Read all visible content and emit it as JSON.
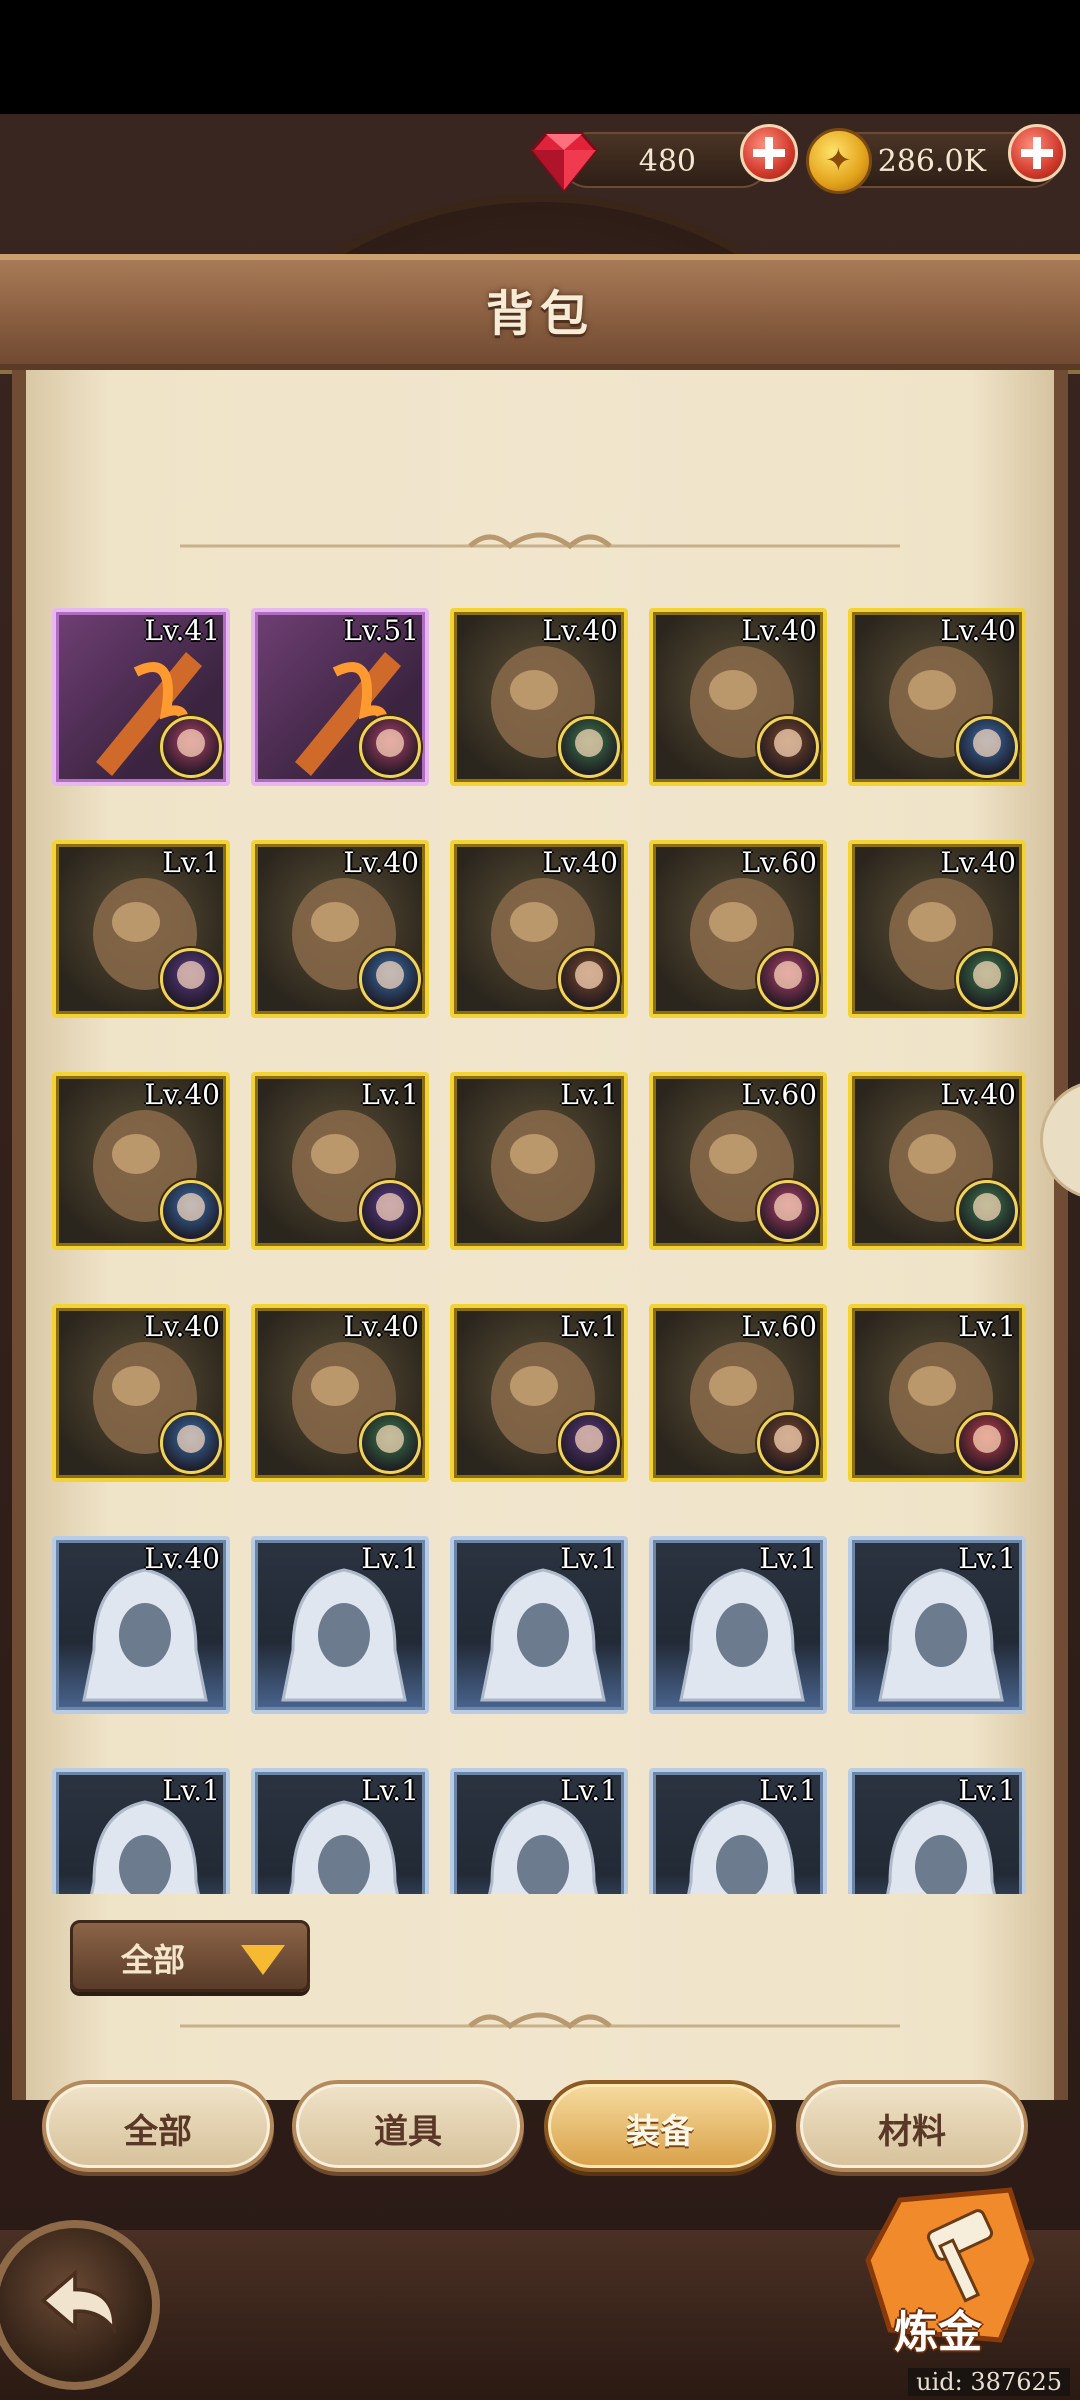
{
  "resources": {
    "gems": "480",
    "gold": "286.0K"
  },
  "title": "背包",
  "items": [
    {
      "lv": "Lv.41",
      "rarity": "purple",
      "icon": "flame-staff-icon",
      "hero": "#b0436b"
    },
    {
      "lv": "Lv.51",
      "rarity": "purple",
      "icon": "scythe-icon",
      "hero": "#b0436b"
    },
    {
      "lv": "Lv.40",
      "rarity": "gold",
      "icon": "stone-gauntlets-icon",
      "hero": "#3c7a4a"
    },
    {
      "lv": "Lv.40",
      "rarity": "gold",
      "icon": "stone-gauntlets-icon",
      "hero": "#7a4a2a"
    },
    {
      "lv": "Lv.40",
      "rarity": "gold",
      "icon": "map-scroll-icon",
      "hero": "#3a6fa8"
    },
    {
      "lv": "Lv.1",
      "rarity": "gold",
      "icon": "emerald-bracelet-icon",
      "hero": "#5c3d8a"
    },
    {
      "lv": "Lv.40",
      "rarity": "gold",
      "icon": "horn-shield-icon",
      "hero": "#3a6fa8"
    },
    {
      "lv": "Lv.40",
      "rarity": "gold",
      "icon": "straw-hat-icon",
      "hero": "#7a4a2a"
    },
    {
      "lv": "Lv.60",
      "rarity": "gold",
      "icon": "crystal-crown-icon",
      "hero": "#b0436b"
    },
    {
      "lv": "Lv.40",
      "rarity": "gold",
      "icon": "knight-helmet-icon",
      "hero": "#3c7a4a"
    },
    {
      "lv": "Lv.40",
      "rarity": "gold",
      "icon": "cloth-tunic-icon",
      "hero": "#3a6fa8"
    },
    {
      "lv": "Lv.1",
      "rarity": "gold",
      "icon": "crimson-robe-icon",
      "hero": "#5c3d8a"
    },
    {
      "lv": "Lv.1",
      "rarity": "gold",
      "icon": "crimson-robe-icon",
      "hero": ""
    },
    {
      "lv": "Lv.60",
      "rarity": "gold",
      "icon": "leather-armor-icon",
      "hero": "#b0436b"
    },
    {
      "lv": "Lv.40",
      "rarity": "gold",
      "icon": "plate-armor-icon",
      "hero": "#3c7a4a"
    },
    {
      "lv": "Lv.40",
      "rarity": "gold",
      "icon": "magic-orb-icon",
      "hero": "#3a6fa8"
    },
    {
      "lv": "Lv.40",
      "rarity": "gold",
      "icon": "shadow-blade-icon",
      "hero": "#3c7a4a"
    },
    {
      "lv": "Lv.1",
      "rarity": "gold",
      "icon": "fire-sword-icon",
      "hero": "#5a3a7a"
    },
    {
      "lv": "Lv.60",
      "rarity": "gold",
      "icon": "bone-bow-icon",
      "hero": "#7a4a2a"
    },
    {
      "lv": "Lv.1",
      "rarity": "gold",
      "icon": "twin-daggers-icon",
      "hero": "#c0404a"
    },
    {
      "lv": "Lv.40",
      "rarity": "blue",
      "icon": "white-hood-icon",
      "hero": ""
    },
    {
      "lv": "Lv.1",
      "rarity": "blue",
      "icon": "white-hood-icon",
      "hero": ""
    },
    {
      "lv": "Lv.1",
      "rarity": "blue",
      "icon": "white-hood-icon",
      "hero": ""
    },
    {
      "lv": "Lv.1",
      "rarity": "blue",
      "icon": "white-hood-icon",
      "hero": ""
    },
    {
      "lv": "Lv.1",
      "rarity": "blue",
      "icon": "white-hood-icon",
      "hero": ""
    },
    {
      "lv": "Lv.1",
      "rarity": "blue",
      "icon": "white-hood-icon",
      "hero": ""
    },
    {
      "lv": "Lv.1",
      "rarity": "blue",
      "icon": "white-hood-icon",
      "hero": ""
    },
    {
      "lv": "Lv.1",
      "rarity": "blue",
      "icon": "white-hood-icon",
      "hero": ""
    },
    {
      "lv": "Lv.1",
      "rarity": "blue",
      "icon": "white-hood-icon",
      "hero": ""
    },
    {
      "lv": "Lv.1",
      "rarity": "blue",
      "icon": "white-hood-icon",
      "hero": ""
    }
  ],
  "filter": {
    "label": "全部"
  },
  "tabs": [
    {
      "label": "全部",
      "active": false
    },
    {
      "label": "道具",
      "active": false
    },
    {
      "label": "装备",
      "active": true
    },
    {
      "label": "材料",
      "active": false
    }
  ],
  "alchemy": {
    "label": "炼金"
  },
  "uid": "uid: 387625"
}
